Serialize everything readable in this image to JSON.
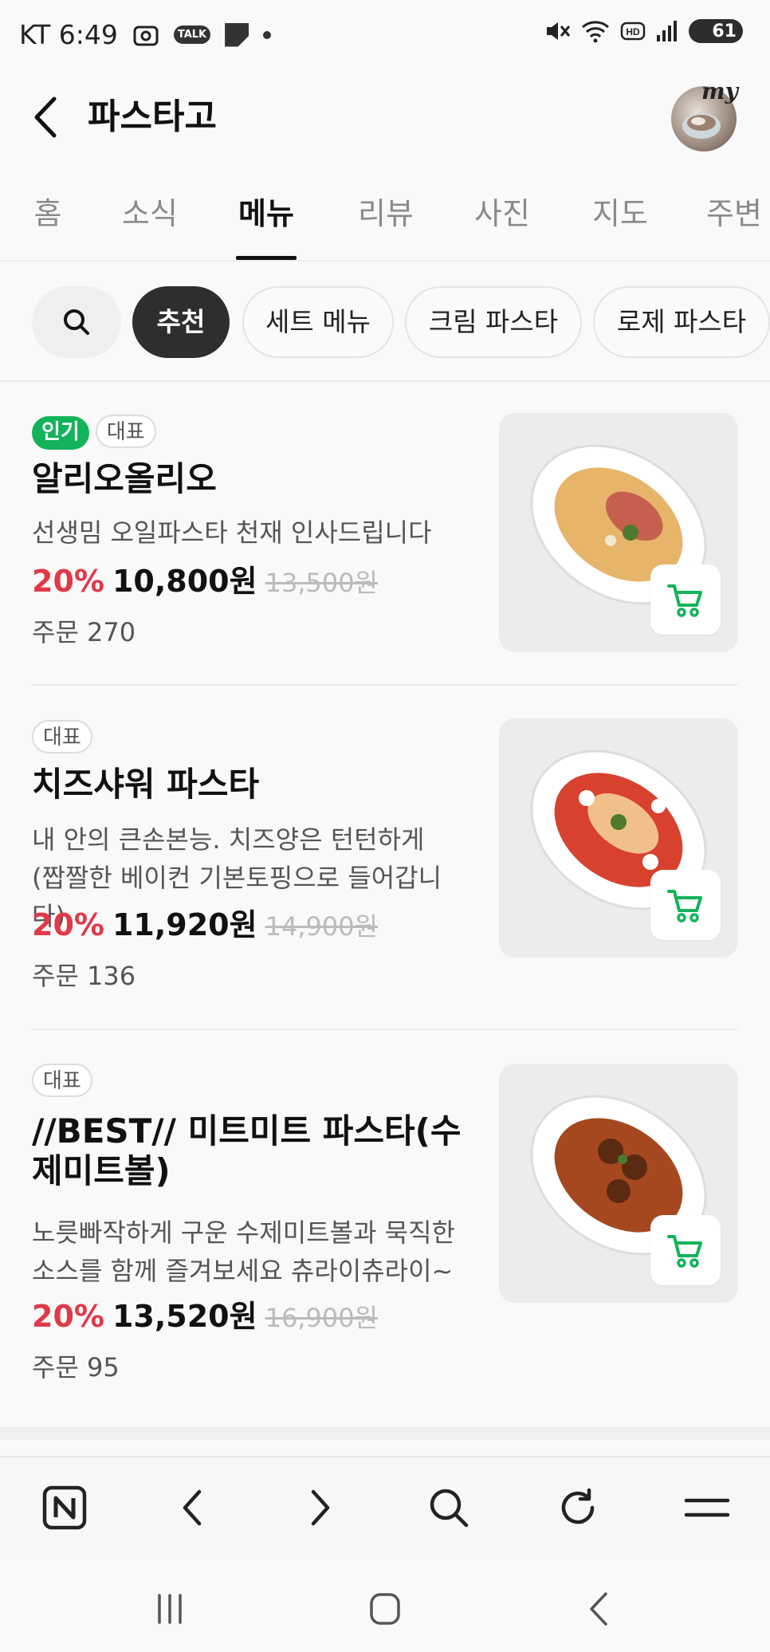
{
  "status_bar": {
    "carrier_time": "KT 6:49",
    "talk_label": "TALK",
    "battery": "61"
  },
  "header": {
    "title": "파스타고",
    "avatar_label": "my"
  },
  "tabs": [
    {
      "label": "홈"
    },
    {
      "label": "소식"
    },
    {
      "label": "메뉴",
      "active": true
    },
    {
      "label": "리뷰"
    },
    {
      "label": "사진"
    },
    {
      "label": "지도"
    },
    {
      "label": "주변"
    }
  ],
  "chips": [
    {
      "label": "추천",
      "active": true
    },
    {
      "label": "세트 메뉴"
    },
    {
      "label": "크림 파스타"
    },
    {
      "label": "로제 파스타"
    }
  ],
  "menu_items": [
    {
      "badges": [
        "인기",
        "대표"
      ],
      "name": "알리오올리오",
      "desc": "선생밈 오일파스타 천재 인사드립니다",
      "discount": "20%",
      "price": "10,800원",
      "original_price": "13,500원",
      "orders": "주문 270"
    },
    {
      "badges": [
        "대표"
      ],
      "name": "치즈샤워 파스타",
      "desc": "내 안의 큰손본능. 치즈양은 턴턴하게 (짭짤한 베이컨 기본토핑으로 들어갑니다)",
      "discount": "20%",
      "price": "11,920원",
      "original_price": "14,900원",
      "orders": "주문 136"
    },
    {
      "badges": [
        "대표"
      ],
      "name": "//BEST// 미트미트 파스타(수제미트볼)",
      "desc": "노릇빠작하게 구운 수제미트볼과 묵직한 소스를 함께 즐겨보세요 츄라이츄라이~",
      "discount": "20%",
      "price": "13,520원",
      "original_price": "16,900원",
      "orders": "주문 95"
    }
  ],
  "colors": {
    "accent_green": "#13b35a",
    "discount_red": "#e0394a",
    "chip_active": "#2e2e2e"
  },
  "icons": {
    "back": "chevron-left-icon",
    "search": "search-icon",
    "cart": "cart-icon"
  }
}
